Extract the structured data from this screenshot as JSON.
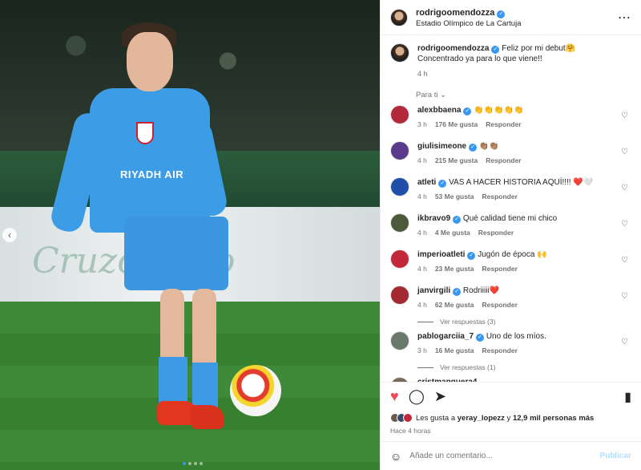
{
  "post": {
    "username": "rodrigoomendozza",
    "location": "Estadio Olímpico de La Cartuja",
    "caption_line1": "Feliz por mi debut🤗",
    "caption_line2": "Concentrado ya para lo que viene!!",
    "caption_time": "4 h",
    "sort_label": "Para ti"
  },
  "photo": {
    "sponsor_text": "RIYADH AIR",
    "board_text": "Cruzcampo"
  },
  "comments": [
    {
      "user": "alexbbaena",
      "text": "👏👏👏👏👏",
      "time": "3 h",
      "likes": "176 Me gusta",
      "reply": "Responder",
      "color": "#b22a3a"
    },
    {
      "user": "giulisimeone",
      "text": "👏🏽👏🏽",
      "time": "4 h",
      "likes": "215 Me gusta",
      "reply": "Responder",
      "color": "#5a3a8a"
    },
    {
      "user": "atleti",
      "text": "VAS A HACER HISTORIA AQUÍ!!!! ❤️🤍",
      "time": "4 h",
      "likes": "53 Me gusta",
      "reply": "Responder",
      "color": "#1f4fa8"
    },
    {
      "user": "ikbravo9",
      "text": "Qué calidad tiene mi chico",
      "time": "4 h",
      "likes": "4 Me gusta",
      "reply": "Responder",
      "color": "#4a5a3a"
    },
    {
      "user": "imperioatleti",
      "text": "Jugón de época 🙌",
      "time": "4 h",
      "likes": "23 Me gusta",
      "reply": "Responder",
      "color": "#c2283a"
    },
    {
      "user": "janvirgili",
      "text": "Rodriiiii❤️",
      "time": "4 h",
      "likes": "62 Me gusta",
      "reply": "Responder",
      "color": "#a22a30"
    },
    {
      "user": "pablogarciia_7",
      "text": "Uno de los míos.",
      "time": "3 h",
      "likes": "16 Me gusta",
      "reply": "Responder",
      "color": "#6a7a6a"
    }
  ],
  "view_replies_1": "Ver respuestas (3)",
  "view_replies_2": "Ver respuestas (1)",
  "partial_user": "cristmanguera4",
  "likes": {
    "prefix": "Les gusta a ",
    "user": "yeray_lopezz",
    "middle": " y ",
    "count": "12,9 mil personas más"
  },
  "ago": "Hace 4 horas",
  "add_comment_placeholder": "Añade un comentario...",
  "publish_label": "Publicar",
  "colors": {
    "accent": "#3897f0",
    "heart": "#ed4956"
  }
}
